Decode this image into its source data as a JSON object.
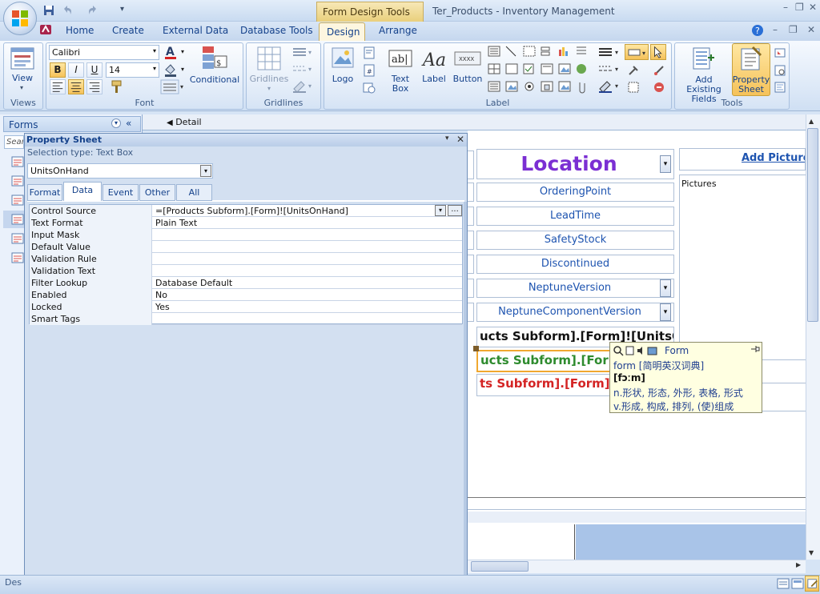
{
  "window": {
    "contextual_tab": "Form Design Tools",
    "title": "Ter_Products - Inventory Management",
    "minimize": "–",
    "restore": "❐",
    "close": "✕"
  },
  "ribbon_tabs": [
    "Home",
    "Create",
    "External Data",
    "Database Tools",
    "Design",
    "Arrange"
  ],
  "groups": {
    "views": {
      "label": "Views",
      "view_button": "View"
    },
    "font": {
      "label": "Font",
      "font_name": "Calibri",
      "font_size": "14",
      "bold": "B",
      "italic": "I",
      "underline": "U",
      "conditional": "Conditional"
    },
    "gridlines": {
      "label": "Gridlines",
      "gridlines_button": "Gridlines"
    },
    "controls": {
      "label": "Label",
      "logo": "Logo",
      "text_box": "Text Box",
      "button": "Button"
    },
    "tools": {
      "label": "Tools",
      "add_existing_fields": "Add Existing Fields",
      "property_sheet": "Property Sheet"
    }
  },
  "nav": {
    "header": "Forms",
    "search_placeholder": "Search...",
    "collapse": "«"
  },
  "section": {
    "detail": "Detail"
  },
  "form_fields": {
    "location": "Location",
    "ordering_point": "OrderingPoint",
    "lead_time": "LeadTime",
    "safety_stock": "SafetyStock",
    "discontinued": "Discontinued",
    "neptune_version": "NeptuneVersion",
    "neptune_component_version": "NeptuneComponentVersion",
    "units_on_hand_black": "ucts Subform].[Form]![UnitsOn",
    "units_on_hand_green": "ucts Subform].[Form",
    "units_on_hand_red": "ts Subform].[Form]![",
    "add_picture": "Add Picture/...",
    "pictures": "Pictures"
  },
  "property_sheet": {
    "title": "Property Sheet",
    "selection_type": "Selection type:  Text Box",
    "selected_object": "UnitsOnHand",
    "tabs": [
      "Format",
      "Data",
      "Event",
      "Other",
      "All"
    ],
    "active_tab": "Data",
    "rows": [
      {
        "name": "Control Source",
        "value": "=[Products Subform].[Form]![UnitsOnHand]"
      },
      {
        "name": "Text Format",
        "value": "Plain Text"
      },
      {
        "name": "Input Mask",
        "value": ""
      },
      {
        "name": "Default Value",
        "value": ""
      },
      {
        "name": "Validation Rule",
        "value": ""
      },
      {
        "name": "Validation Text",
        "value": ""
      },
      {
        "name": "Filter Lookup",
        "value": "Database Default"
      },
      {
        "name": "Enabled",
        "value": "No"
      },
      {
        "name": "Locked",
        "value": "Yes"
      },
      {
        "name": "Smart Tags",
        "value": ""
      }
    ],
    "builder_button": "..."
  },
  "dictionary_popup": {
    "header": "Form",
    "line1": "form [简明英汉词典]",
    "phonetic": "[fɔːm]",
    "noun": "n.形状, 形态, 外形, 表格, 形式",
    "verb": "v.形成, 构成, 排列, (使)组成"
  },
  "status": {
    "text": "Des"
  },
  "colors": {
    "location_purple": "#7b2fd3",
    "field_blue": "#1e54b0",
    "green_text": "#2e8b2e",
    "red_text": "#d42424",
    "selection_orange": "#f0a830"
  }
}
